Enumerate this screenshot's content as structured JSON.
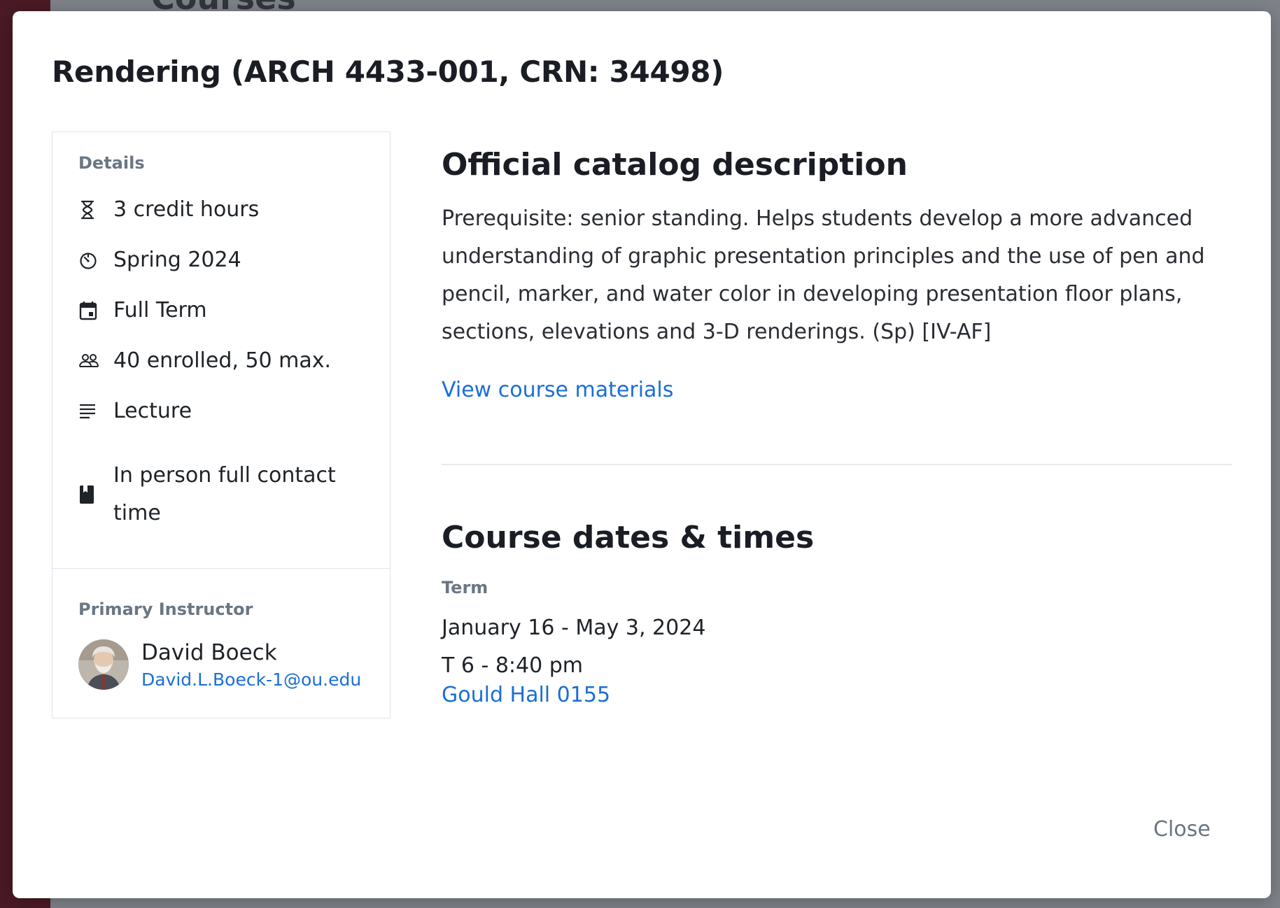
{
  "background": {
    "page_heading": "Courses"
  },
  "modal": {
    "title": "Rendering (ARCH 4433-001, CRN: 34498)",
    "details": {
      "label": "Details",
      "items": [
        {
          "icon": "hourglass-icon",
          "text": "3 credit hours"
        },
        {
          "icon": "timer-icon",
          "text": "Spring 2024"
        },
        {
          "icon": "calendar-icon",
          "text": "Full Term"
        },
        {
          "icon": "people-icon",
          "text": "40 enrolled, 50 max."
        },
        {
          "icon": "lines-icon",
          "text": "Lecture"
        },
        {
          "icon": "book-icon",
          "text": "In person full contact time"
        }
      ]
    },
    "instructor": {
      "label": "Primary Instructor",
      "name": "David Boeck",
      "email": "David.L.Boeck-1@ou.edu"
    },
    "catalog": {
      "heading": "Official catalog description",
      "description": "Prerequisite: senior standing. Helps students develop a more advanced understanding of graphic presentation principles and the use of pen and pencil, marker, and water color in developing presentation floor plans, sections, elevations and 3-D renderings. (Sp) [IV-AF]",
      "materials_link": "View course materials"
    },
    "dates": {
      "heading": "Course dates & times",
      "term_label": "Term",
      "term_range": "January 16 - May 3, 2024",
      "meeting_time": "T 6 - 8:40 pm",
      "location": "Gould Hall 0155"
    },
    "close_label": "Close"
  },
  "colors": {
    "link": "#1a6fd6",
    "muted": "#6b7683",
    "text": "#1f2328",
    "backdrop": "#7e8288",
    "brand_crimson": "#4a1a26"
  }
}
